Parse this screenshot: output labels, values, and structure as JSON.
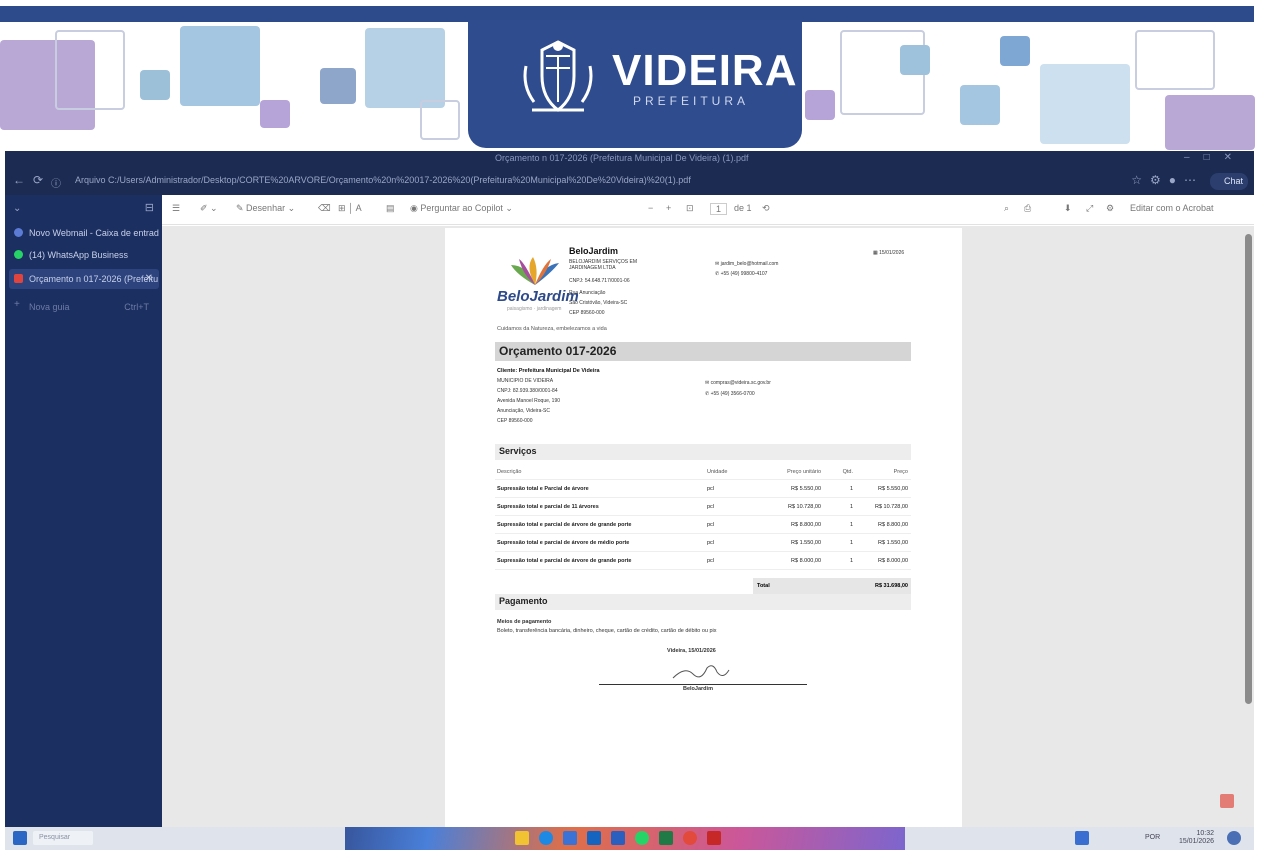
{
  "banner": {
    "brand": "VIDEIRA",
    "subtitle": "PREFEITURA",
    "brand_color": "#2f4c8e"
  },
  "browser": {
    "window_title": "Orçamento n 017-2026 (Prefeitura Municipal De Videira) (1).pdf",
    "address_label": "Arquivo",
    "url": "C:/Users/Administrador/Desktop/CORTE%20ARVORE/Orçamento%20n%20017-2026%20(Prefeitura%20Municipal%20De%20Videira)%20(1).pdf",
    "copilot_label": "Chat",
    "tabs": [
      {
        "label": "Novo Webmail - Caixa de entrada",
        "icon": "mail-icon",
        "color": "#5b7bd5"
      },
      {
        "label": "(14) WhatsApp Business",
        "icon": "whatsapp-icon",
        "color": "#25d366"
      },
      {
        "label": "Orçamento n 017-2026 (Prefeitu",
        "icon": "pdf-icon",
        "color": "#e0443e"
      },
      {
        "label": "Nova guia",
        "icon": "plus-icon",
        "color": "#5b7bd5"
      }
    ],
    "tab_shortcut": "Ctrl+T"
  },
  "toolbar": {
    "draw_label": "Desenhar",
    "copilot_ask": "Perguntar ao Copilot",
    "page_current": "1",
    "page_total": "de 1",
    "zoom_minus": "−",
    "zoom_plus": "+",
    "accessibility": "Editar com o Acrobat"
  },
  "doc": {
    "company": {
      "name": "BeloJardim",
      "legal_name": "BELOJARDIM SERVIÇOS EM JARDINAGEM LTDA",
      "cnpj": "CNPJ: 54.648.717/0001-06",
      "street": "Rua Anunciação",
      "city": "São Cristóvão, Videira-SC",
      "cep": "CEP 89560-000",
      "email": "jardim_belo@hotmail.com",
      "phone": "+55 (49) 99800-4107",
      "date": "15/01/2026",
      "tagline": "Cuidamos da Natureza, embelezamos a vida",
      "logo_word": "BeloJardim",
      "logo_tag": "paisagismo · jardinagem"
    },
    "title": "Orçamento 017-2026",
    "client": {
      "name": "Cliente: Prefeitura Municipal De Videira",
      "municipio": "MUNICIPIO DE VIDEIRA",
      "cnpj": "CNPJ: 82.939.380/0001-84",
      "street": "Avenida Manoel Roque, 190",
      "city": "Anunciação, Videira-SC",
      "cep": "CEP 89560-000",
      "email": "compras@videira.sc.gov.br",
      "phone": "+55 (49) 3566-0700"
    },
    "services": {
      "heading": "Serviços",
      "headers": [
        "Descrição",
        "Unidade",
        "Preço unitário",
        "Qtd.",
        "Preço"
      ],
      "rows": [
        [
          "Supressão total e Parcial de árvore",
          "pcl",
          "R$ 5.550,00",
          "1",
          "R$ 5.550,00"
        ],
        [
          "Supressão total e parcial de 11 árvores",
          "pcl",
          "R$ 10.728,00",
          "1",
          "R$ 10.728,00"
        ],
        [
          "Supressão total e parcial de árvore de grande porte",
          "pcl",
          "R$ 8.800,00",
          "1",
          "R$ 8.800,00"
        ],
        [
          "Supressão total e parcial de árvore de médio porte",
          "pcl",
          "R$ 1.550,00",
          "1",
          "R$ 1.550,00"
        ],
        [
          "Supressão total e parcial de árvore de grande porte",
          "pcl",
          "R$ 8.000,00",
          "1",
          "R$ 8.000,00"
        ]
      ],
      "total_label": "Total",
      "total_value": "R$ 31.698,00"
    },
    "payment": {
      "heading": "Pagamento",
      "methods_label": "Meios de pagamento",
      "methods": "Boleto, transferência bancária, dinheiro, cheque, cartão de crédito, cartão de débito ou pix"
    },
    "sign_place_date": "Videira, 15/01/2026",
    "signer": "BeloJardim"
  },
  "taskbar": {
    "search": "Pesquisar",
    "time": "10:32",
    "date": "15/01/2026",
    "lang": "POR"
  }
}
